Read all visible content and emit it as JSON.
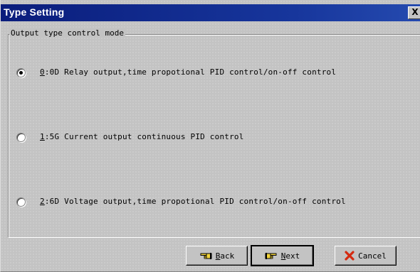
{
  "window": {
    "title": "Type Setting",
    "close_label": "X"
  },
  "group": {
    "label": "Output type control mode"
  },
  "options": [
    {
      "key": "0",
      "rest": ":0D Relay output,time propotional PID control/on-off control",
      "selected": true
    },
    {
      "key": "1",
      "rest": ":5G Current output continuous PID control",
      "selected": false
    },
    {
      "key": "2",
      "rest": ":6D Voltage output,time propotional PID control/on-off control",
      "selected": false
    }
  ],
  "buttons": {
    "back": {
      "mnemonic": "B",
      "rest": "ack",
      "icon": "back-hand-icon"
    },
    "next": {
      "mnemonic": "N",
      "rest": "ext",
      "icon": "next-hand-icon"
    },
    "cancel": {
      "label": "Cancel",
      "icon": "red-x-icon",
      "icon_color": "#d42a10"
    }
  }
}
